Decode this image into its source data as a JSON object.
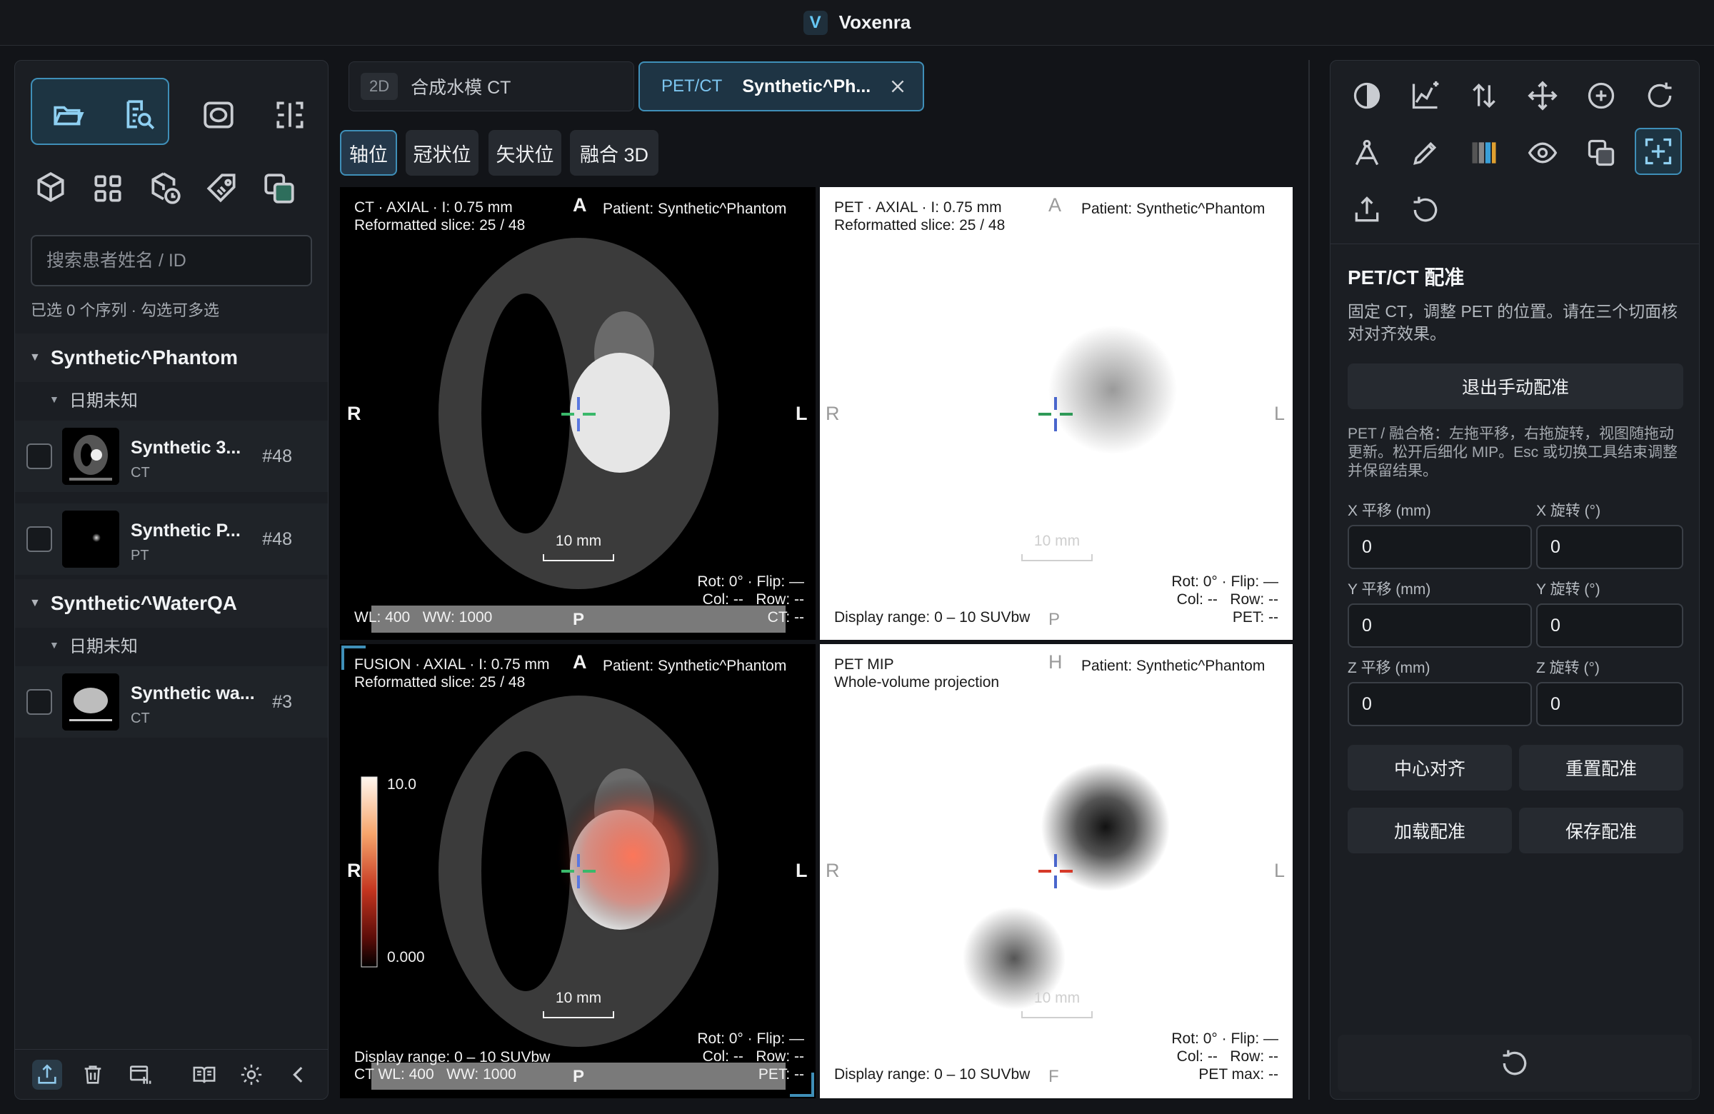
{
  "app": {
    "title": "Voxenra",
    "logo_glyph": "V"
  },
  "sidebar": {
    "toolbar": [
      {
        "icon": "folder-open-icon"
      },
      {
        "icon": "search-document-icon"
      },
      {
        "icon": "ellipse-roi-icon"
      },
      {
        "icon": "crop-frame-icon"
      },
      {
        "icon": "cube-icon"
      },
      {
        "icon": "grid-layout-icon"
      },
      {
        "icon": "cube-clock-icon"
      },
      {
        "icon": "tag-icon"
      },
      {
        "icon": "layers-overlay-icon"
      }
    ],
    "search_placeholder": "搜索患者姓名 / ID",
    "selection_hint": "已选 0 个序列 · 勾选可多选",
    "groups": [
      {
        "patient": "Synthetic^Phantom",
        "date": "日期未知",
        "series": [
          {
            "name": "Synthetic 3...",
            "modality": "CT",
            "count": "#48"
          },
          {
            "name": "Synthetic P...",
            "modality": "PT",
            "count": "#48"
          }
        ]
      },
      {
        "patient": "Synthetic^WaterQA",
        "date": "日期未知",
        "series": [
          {
            "name": "Synthetic wa...",
            "modality": "CT",
            "count": "#3"
          }
        ]
      }
    ],
    "bottom_icons": [
      "export-icon",
      "trash-icon",
      "series-stack-icon",
      "book-icon",
      "gear-icon",
      "chevron-left-icon"
    ]
  },
  "tabs": [
    {
      "pill": "2D",
      "title": "合成水模 CT"
    },
    {
      "modality": "PET/CT",
      "title": "Synthetic^Ph...",
      "close": "close-icon"
    }
  ],
  "views": [
    {
      "label": "轴位",
      "active": true
    },
    {
      "label": "冠状位",
      "active": false
    },
    {
      "label": "矢状位",
      "active": false
    },
    {
      "label": "融合 3D",
      "active": false
    }
  ],
  "viewports": {
    "ct": {
      "line1": "CT · AXIAL · I: 0.75 mm",
      "line2": "Reformatted slice: 25 / 48",
      "patient": "Patient: Synthetic^Phantom",
      "top": "A",
      "left": "R",
      "right": "L",
      "bottom": "P",
      "scale": "10 mm",
      "rot": "Rot: 0° · Flip: —",
      "colrow": "Col: --   Row: --",
      "value": "CT: --",
      "wl": "WL: 400   WW: 1000"
    },
    "pet": {
      "line1": "PET · AXIAL · I: 0.75 mm",
      "line2": "Reformatted slice: 25 / 48",
      "patient": "Patient: Synthetic^Phantom",
      "top": "A",
      "left": "R",
      "right": "L",
      "bottom": "P",
      "scale": "10 mm",
      "rot": "Rot: 0° · Flip: —",
      "colrow": "Col: --   Row: --",
      "value": "PET: --",
      "range": "Display range: 0 – 10 SUVbw"
    },
    "fusion": {
      "line1": "FUSION · AXIAL · I: 0.75 mm",
      "line2": "Reformatted slice: 25 / 48",
      "patient": "Patient: Synthetic^Phantom",
      "top": "A",
      "left": "R",
      "right": "L",
      "bottom": "P",
      "scale": "10 mm",
      "colorbar_max": "10.0",
      "colorbar_min": "0.000",
      "rot": "Rot: 0° · Flip: —",
      "colrow": "Col: --   Row: --",
      "value": "PET: --",
      "range": "Display range: 0 – 10 SUVbw",
      "wl": "CT WL: 400   WW: 1000"
    },
    "mip": {
      "line1": "PET MIP",
      "line2": "Whole-volume projection",
      "patient": "Patient: Synthetic^Phantom",
      "top": "H",
      "left": "R",
      "right": "L",
      "bottom": "F",
      "scale": "10 mm",
      "rot": "Rot: 0° · Flip: —",
      "colrow": "Col: --   Row: --",
      "value": "PET max: --",
      "range": "Display range: 0 – 10 SUVbw"
    }
  },
  "right_panel": {
    "toolbar": [
      "contrast-icon",
      "histogram-icon",
      "swap-vertical-icon",
      "move-icon",
      "zoom-in-icon",
      "rotate-icon",
      "angle-measure-icon",
      "pencil-icon",
      "color-map-icon",
      "eye-icon",
      "overlay-icon",
      "registration-icon",
      "upload-icon",
      "reset-icon"
    ],
    "title": "PET/CT 配准",
    "description": "固定 CT，调整 PET 的位置。请在三个切面核对对齐效果。",
    "exit_button": "退出手动配准",
    "help": "PET / 融合格：左拖平移，右拖旋转，视图随拖动更新。松开后细化 MIP。Esc 或切换工具结束调整并保留结果。",
    "fields": [
      {
        "label": "X 平移 (mm)",
        "value": "0"
      },
      {
        "label": "X 旋转 (°)",
        "value": "0"
      },
      {
        "label": "Y 平移 (mm)",
        "value": "0"
      },
      {
        "label": "Y 旋转 (°)",
        "value": "0"
      },
      {
        "label": "Z 平移 (mm)",
        "value": "0"
      },
      {
        "label": "Z 旋转 (°)",
        "value": "0"
      }
    ],
    "buttons": [
      "中心对齐",
      "重置配准",
      "加载配准",
      "保存配准"
    ],
    "bottom_icon": "reset-icon"
  },
  "colors": {
    "accent": "#3f8fb8",
    "accent_text": "#7cc5ef",
    "background": "#121418",
    "panel": "#1b1e23"
  }
}
